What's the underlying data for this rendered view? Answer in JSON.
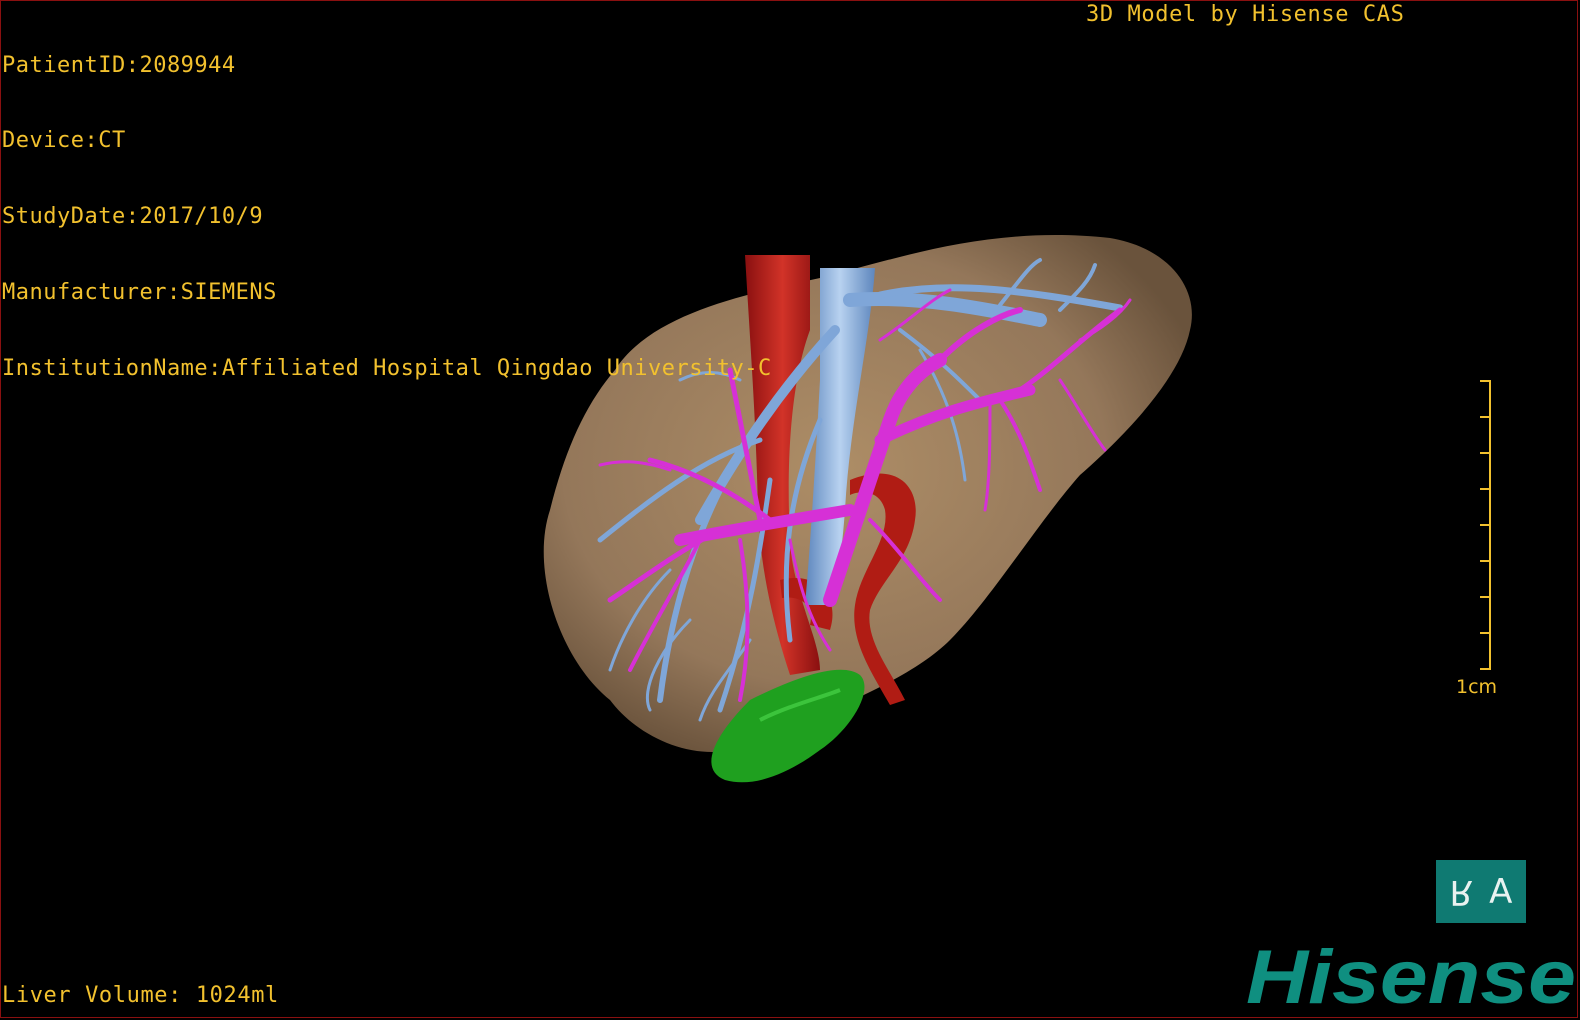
{
  "overlay": {
    "patient_id": "PatientID:2089944",
    "device": "Device:CT",
    "study_date": "StudyDate:2017/10/9",
    "manufacturer": "Manufacturer:SIEMENS",
    "institution": "InstitutionName:Affiliated Hospital Qingdao University-C",
    "model_by": "3D Model by Hisense CAS",
    "liver_volume": "Liver Volume: 1024ml"
  },
  "scale": {
    "label": "1cm"
  },
  "orientation_button": {
    "left_glyph": "R",
    "right_glyph": "A"
  },
  "brand": {
    "logo_text": "Hisense",
    "color": "#0f8f80"
  },
  "model_colors": {
    "liver": "#9c7e5c",
    "aorta": "#c22018",
    "hepatic_vein": "#7fa6d8",
    "portal_vein": "#d630d6",
    "gallbladder": "#1fa01f"
  }
}
